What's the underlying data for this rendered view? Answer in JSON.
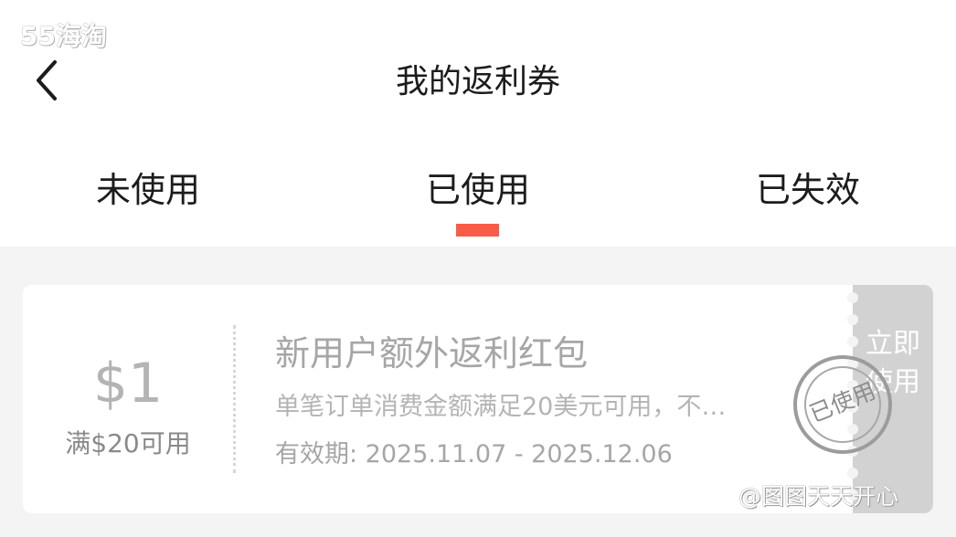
{
  "watermarks": {
    "top_logo": "55海淘",
    "bottom_credit": "@图图天天开心"
  },
  "header": {
    "title": "我的返利券",
    "back_icon": "chevron-left-icon"
  },
  "tabs": [
    {
      "label": "未使用",
      "active": false
    },
    {
      "label": "已使用",
      "active": true
    },
    {
      "label": "已失效",
      "active": false
    }
  ],
  "coupons": [
    {
      "amount": "$1",
      "threshold": "满$20可用",
      "name": "新用户额外返利红包",
      "description": "单笔订单消费金额满足20美元可用，不…",
      "validity": "有效期: 2025.11.07 - 2025.12.06",
      "action_label": "立即使用",
      "stamp": "已使用"
    }
  ],
  "colors": {
    "accent": "#fa5b48",
    "page_background": "#f4f4f4",
    "card_background": "#ffffff",
    "stub_background": "#d2d2d2",
    "muted_text": "#a6a6a6"
  }
}
